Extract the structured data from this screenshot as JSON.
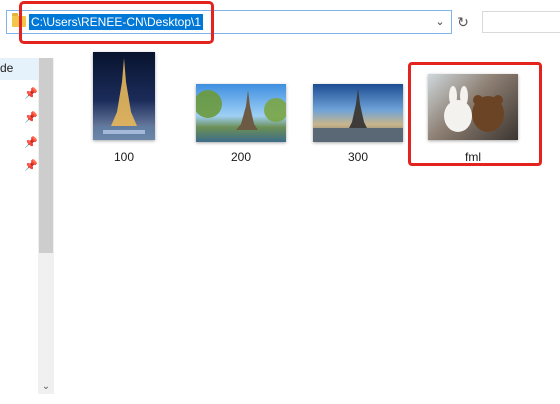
{
  "address_bar": {
    "path": "C:\\Users\\RENEE-CN\\Desktop\\1",
    "dropdown_icon": "chevron-down-icon",
    "refresh_icon": "refresh-icon"
  },
  "nav": {
    "item_label": "de",
    "pins": [
      "pin-icon",
      "pin-icon",
      "pin-icon",
      "pin-icon"
    ]
  },
  "files": [
    {
      "name": "100"
    },
    {
      "name": "200"
    },
    {
      "name": "300"
    },
    {
      "name": "fml"
    }
  ],
  "colors": {
    "highlight": "#e3241e",
    "selection": "#0078d7",
    "nav_selected": "#e5f1fb"
  }
}
